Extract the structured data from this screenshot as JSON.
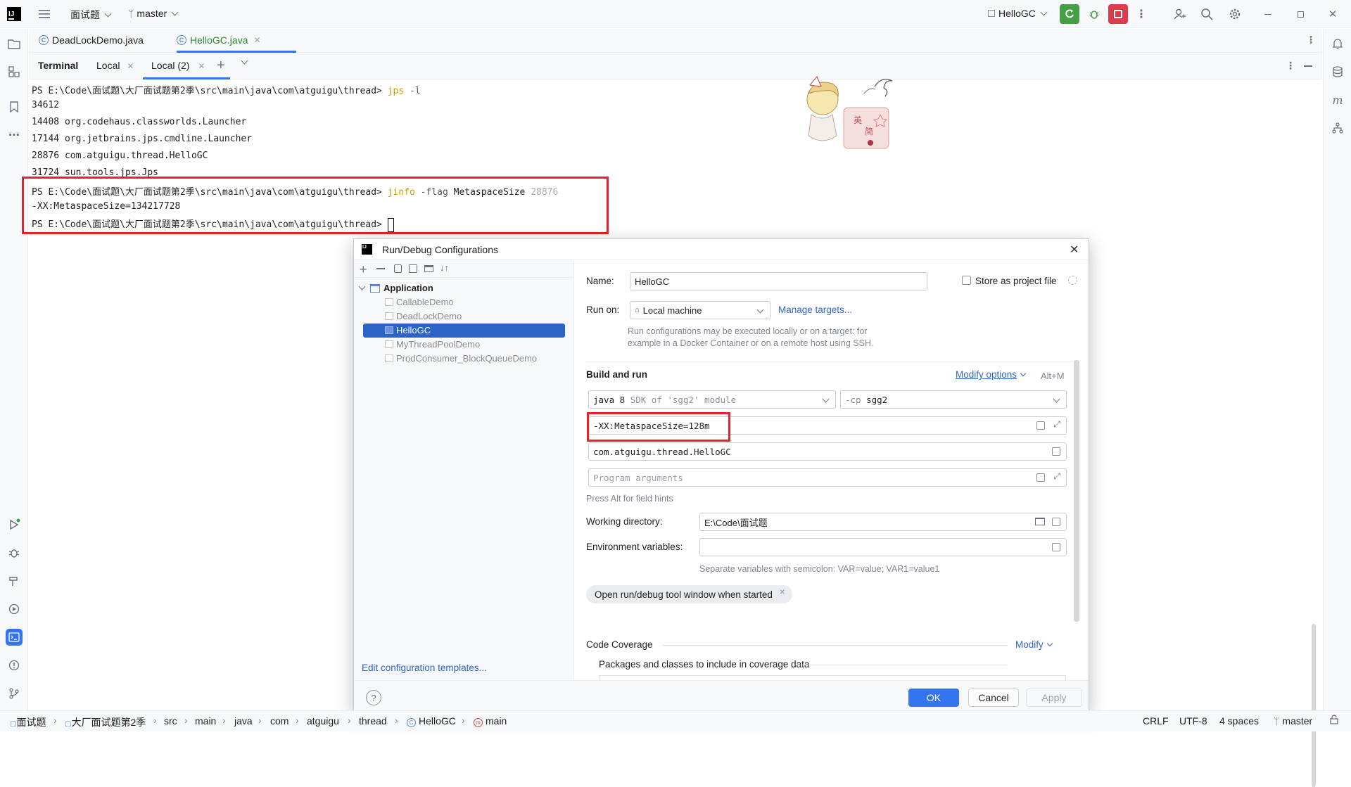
{
  "topbar": {
    "project": "面试题",
    "branch": "master",
    "run_config": "HelloGC"
  },
  "editor_tabs": [
    {
      "label": "DeadLockDemo.java",
      "active": false
    },
    {
      "label": "HelloGC.java",
      "active": true
    }
  ],
  "terminal": {
    "title": "Terminal",
    "tabs": [
      {
        "label": "Local"
      },
      {
        "label": "Local (2)"
      }
    ],
    "prompt": "PS E:\\Code\\面试题\\大厂面试题第2季\\src\\main\\java\\com\\atguigu\\thread>",
    "lines": [
      {
        "cmd": "jps",
        "args": "-l"
      },
      {
        "out": "34612"
      },
      {
        "out": "14408 org.codehaus.classworlds.Launcher"
      },
      {
        "out": "17144 org.jetbrains.jps.cmdline.Launcher"
      },
      {
        "out": "28876 com.atguigu.thread.HelloGC"
      },
      {
        "out": "31724 sun.tools.jps.Jps"
      },
      {
        "cmd": "jinfo",
        "args": "-flag",
        "flag": "MetaspaceSize",
        "pid": "28876"
      },
      {
        "out": "-XX:MetaspaceSize=134217728"
      }
    ]
  },
  "sticker": {
    "chars": [
      "英",
      "简"
    ]
  },
  "dialog": {
    "title": "Run/Debug Configurations",
    "tree": {
      "group": "Application",
      "items": [
        "CallableDemo",
        "DeadLockDemo",
        "HelloGC",
        "MyThreadPoolDemo",
        "ProdConsumer_BlockQueueDemo"
      ],
      "selected": "HelloGC"
    },
    "edit_templates": "Edit configuration templates...",
    "name_label": "Name:",
    "name_value": "HelloGC",
    "store_label": "Store as project file",
    "run_on_label": "Run on:",
    "run_on_value": "Local machine",
    "manage_targets": "Manage targets...",
    "run_on_hint_1": "Run configurations may be executed locally or on a target: for",
    "run_on_hint_2": "example in a Docker Container or on a remote host using SSH.",
    "build_and_run": "Build and run",
    "modify_options": "Modify options",
    "modify_shortcut": "Alt+M",
    "sdk_main": "java 8",
    "sdk_hint": "SDK of 'sgg2' module",
    "cp_label": "-cp",
    "cp_value": "sgg2",
    "vm_options": "-XX:MetaspaceSize=128m",
    "main_class": "com.atguigu.thread.HelloGC",
    "program_args_placeholder": "Program arguments",
    "field_hint": "Press Alt for field hints",
    "working_dir_label": "Working directory:",
    "working_dir_value": "E:\\Code\\面试题",
    "env_label": "Environment variables:",
    "env_hint": "Separate variables with semicolon: VAR=value; VAR1=value1",
    "open_tool_window": "Open run/debug tool window when started",
    "code_coverage": "Code Coverage",
    "coverage_modify": "Modify",
    "packages_label": "Packages and classes to include in coverage data",
    "ok": "OK",
    "cancel": "Cancel",
    "apply": "Apply"
  },
  "breadcrumb": [
    "面试题",
    "大厂面试题第2季",
    "src",
    "main",
    "java",
    "com",
    "atguigu",
    "thread",
    "HelloGC",
    "main"
  ],
  "status": {
    "line_sep": "CRLF",
    "encoding": "UTF-8",
    "indent": "4 spaces",
    "branch": "master"
  },
  "colors": {
    "accent": "#3574f0",
    "highlight": "#e8212b",
    "selection": "#2b64c6"
  }
}
